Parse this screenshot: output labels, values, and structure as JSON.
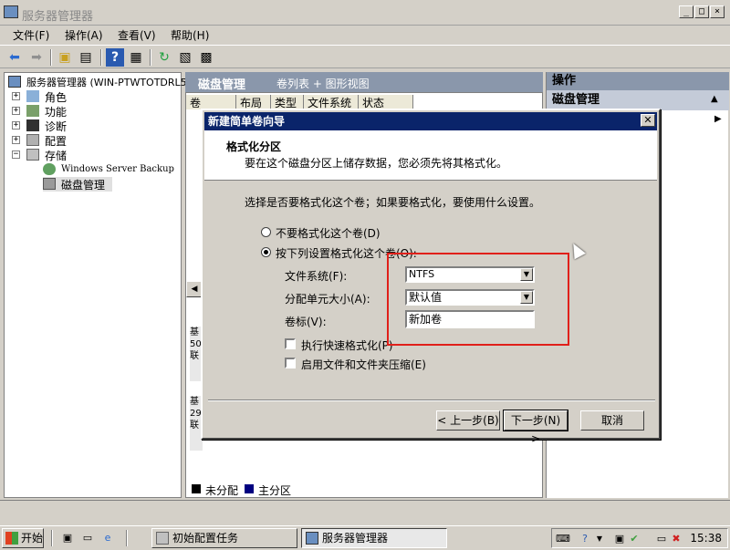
{
  "window": {
    "title": "服务器管理器",
    "controls": [
      "_",
      "□",
      "×"
    ]
  },
  "menu": [
    "文件(F)",
    "操作(A)",
    "查看(V)",
    "帮助(H)"
  ],
  "tree": {
    "root": "服务器管理器 (WIN-PTWTOTDRL5",
    "items": [
      "角色",
      "功能",
      "诊断",
      "配置",
      "存储"
    ],
    "storage_children": [
      "Windows Server Backup",
      "磁盘管理"
    ]
  },
  "center": {
    "title": "磁盘管理",
    "view": "卷列表 + 图形视图",
    "columns": [
      "卷",
      "布局",
      "类型",
      "文件系统",
      "状态"
    ],
    "disk1": [
      "基",
      "50",
      "联"
    ],
    "disk2": [
      "基",
      "29",
      "联"
    ],
    "legend": [
      "未分配",
      "主分区"
    ]
  },
  "actions": {
    "header": "操作",
    "section": "磁盘管理"
  },
  "dialog": {
    "title": "新建简单卷向导",
    "heading": "格式化分区",
    "subheading": "要在这个磁盘分区上储存数据，您必须先将其格式化。",
    "description": "选择是否要格式化这个卷；如果要格式化，要使用什么设置。",
    "option_no_format": "不要格式化这个卷(D)",
    "option_format": "按下列设置格式化这个卷(O):",
    "fs_label": "文件系统(F):",
    "fs_value": "NTFS",
    "alloc_label": "分配单元大小(A):",
    "alloc_value": "默认值",
    "volume_label": "卷标(V):",
    "volume_value": "新加卷",
    "quick_format": "执行快速格式化(P)",
    "compression": "启用文件和文件夹压缩(E)",
    "back": "< 上一步(B)",
    "next": "下一步(N) >",
    "cancel": "取消"
  },
  "taskbar": {
    "start": "开始",
    "tasks": [
      "初始配置任务",
      "服务器管理器"
    ],
    "clock": "15:38"
  },
  "colors": {
    "highlight": "#e0201a",
    "title_bar": "#0a246a",
    "pane_header": "#8a97ab",
    "unallocated": "#000000",
    "primary_partition": "#000080"
  }
}
